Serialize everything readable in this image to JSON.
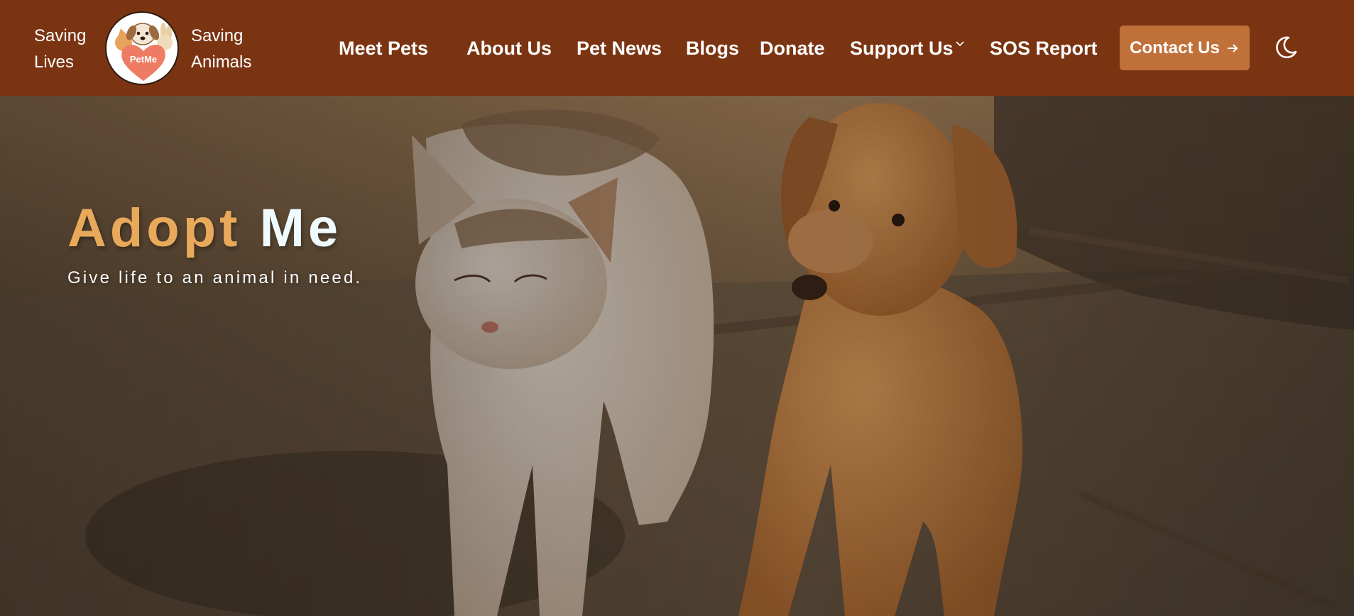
{
  "brand": {
    "left_line1": "Saving",
    "left_line2": "Lives",
    "right_line1": "Saving",
    "right_line2": "Animals",
    "logo_text": "PetMe"
  },
  "nav": {
    "items": [
      {
        "label": "Meet Pets"
      },
      {
        "label": "About Us"
      },
      {
        "label": "Pet News"
      },
      {
        "label": "Blogs"
      },
      {
        "label": "Donate"
      },
      {
        "label": "Support Us"
      },
      {
        "label": "SOS Report"
      }
    ],
    "contact_label": "Contact Us",
    "contact_icon": "arrow-right-icon",
    "theme_icon": "moon-icon"
  },
  "hero": {
    "title_word1": "Adopt",
    "title_word2": "Me",
    "subtitle": "Give life to an animal in need."
  },
  "colors": {
    "navbar": "#7b3412",
    "accent_button": "#c0713a",
    "title_accent": "#e8a95a",
    "title_light": "#f0fbff"
  }
}
